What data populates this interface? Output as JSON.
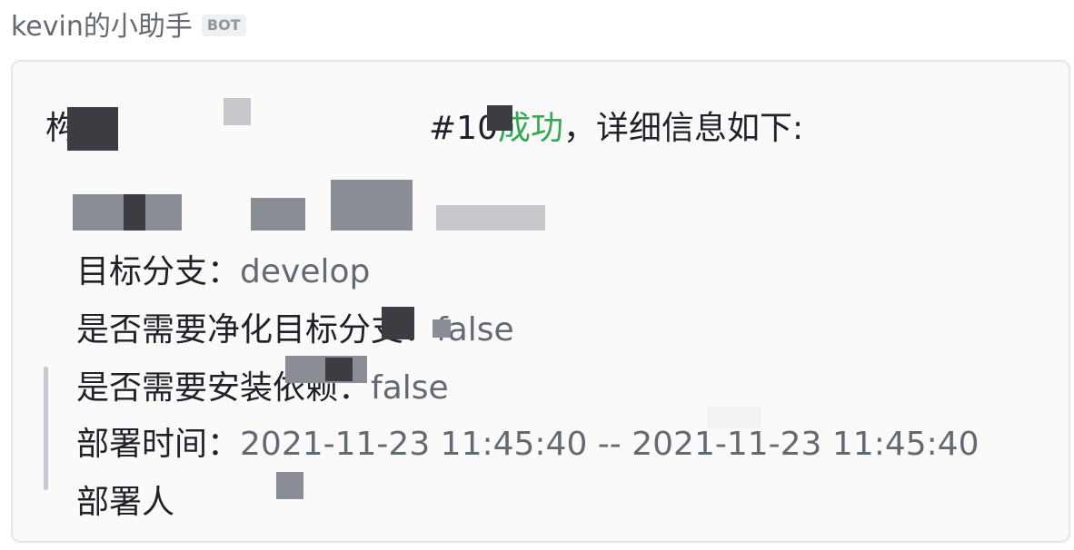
{
  "header": {
    "sender_name": "kevin的小助手",
    "badge": "BOT"
  },
  "card": {
    "title_prefix": "构建",
    "title_build": "#10",
    "title_status": "成功",
    "title_suffix": "，详细信息如下:",
    "rows": [
      {
        "label": "项",
        "value": ""
      },
      {
        "label": "目标分支：",
        "value": "develop"
      },
      {
        "label": "是否需要净化目标分支：",
        "value": "false"
      },
      {
        "label": "是否需要安装依赖：",
        "value": "false"
      },
      {
        "label": "部署时间：",
        "value": "2021-11-23 11:45:40 -- 2021-11-23 11:45:40"
      },
      {
        "label": "部署人",
        "value": ""
      }
    ]
  },
  "colors": {
    "success": "#34a853",
    "label": "#1f2329",
    "value": "#646a73",
    "card_bg": "#fafafa",
    "card_border": "#e5e6eb"
  }
}
